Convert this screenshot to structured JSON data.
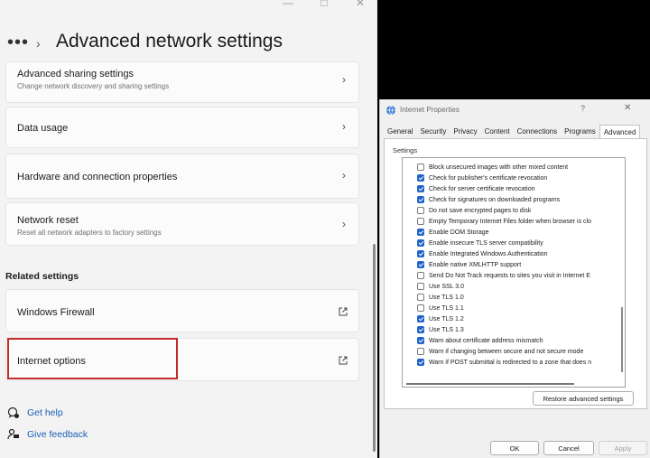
{
  "settings": {
    "window_controls": [
      "—",
      "□",
      "✕"
    ],
    "breadcrumb_more": "•••",
    "breadcrumb_chevron": "›",
    "title": "Advanced network settings",
    "cards": [
      {
        "title": "Advanced sharing settings",
        "subtitle": "Change network discovery and sharing settings"
      },
      {
        "title": "Data usage"
      },
      {
        "title": "Hardware and connection properties"
      },
      {
        "title": "Network reset",
        "subtitle": "Reset all network adapters to factory settings"
      }
    ],
    "related_heading": "Related settings",
    "related": [
      {
        "title": "Windows Firewall"
      },
      {
        "title": "Internet options"
      }
    ],
    "help_links": [
      {
        "label": "Get help",
        "icon": "help-chat-icon"
      },
      {
        "label": "Give feedback",
        "icon": "feedback-icon"
      }
    ],
    "highlight_color": "#c42b2b"
  },
  "dialog": {
    "title": "Internet Properties",
    "help_glyph": "?",
    "close_glyph": "✕",
    "tabs": [
      "General",
      "Security",
      "Privacy",
      "Content",
      "Connections",
      "Programs",
      "Advanced"
    ],
    "active_tab": "Advanced",
    "settings_label": "Settings",
    "options": [
      {
        "label": "Block unsecured images with other mixed content",
        "checked": false
      },
      {
        "label": "Check for publisher's certificate revocation",
        "checked": true
      },
      {
        "label": "Check for server certificate revocation",
        "checked": true
      },
      {
        "label": "Check for signatures on downloaded programs",
        "checked": true
      },
      {
        "label": "Do not save encrypted pages to disk",
        "checked": false
      },
      {
        "label": "Empty Temporary Internet Files folder when browser is clo",
        "checked": false
      },
      {
        "label": "Enable DOM Storage",
        "checked": true
      },
      {
        "label": "Enable insecure TLS server compatibility",
        "checked": true
      },
      {
        "label": "Enable Integrated Windows Authentication",
        "checked": true
      },
      {
        "label": "Enable native XMLHTTP support",
        "checked": true
      },
      {
        "label": "Send Do Not Track requests to sites you visit in Internet E",
        "checked": false
      },
      {
        "label": "Use SSL 3.0",
        "checked": false
      },
      {
        "label": "Use TLS 1.0",
        "checked": false
      },
      {
        "label": "Use TLS 1.1",
        "checked": false
      },
      {
        "label": "Use TLS 1.2",
        "checked": true
      },
      {
        "label": "Use TLS 1.3",
        "checked": true
      },
      {
        "label": "Warn about certificate address mismatch",
        "checked": true
      },
      {
        "label": "Warn if changing between secure and not secure mode",
        "checked": false
      },
      {
        "label": "Warn if POST submittal is redirected to a zone that does n",
        "checked": true
      }
    ],
    "restore_button": "Restore advanced settings",
    "ok_button": "OK",
    "cancel_button": "Cancel",
    "apply_button": "Apply",
    "accent_color": "#1e63c9"
  }
}
